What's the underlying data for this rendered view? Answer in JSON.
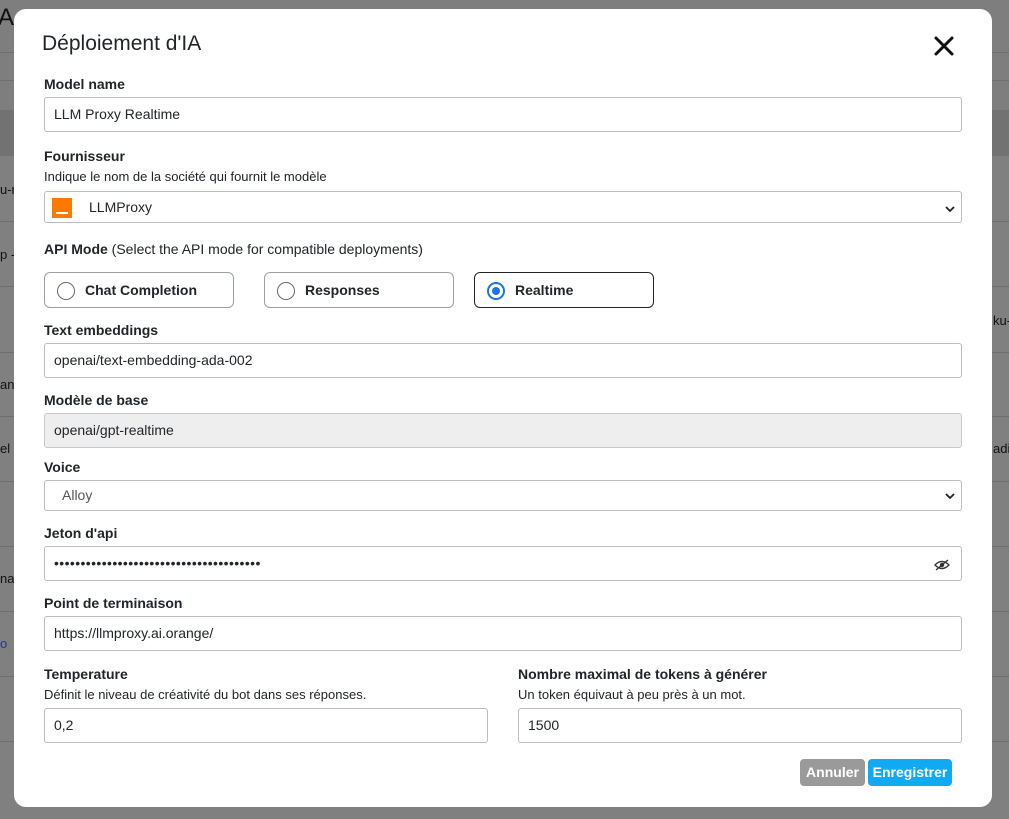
{
  "background": {
    "title": "A",
    "fragments": [
      "u-n",
      "p -",
      "ant",
      "el",
      "na",
      "o",
      "ku-",
      "adi"
    ]
  },
  "modal": {
    "title": "Déploiement d'IA",
    "close_icon": "close-icon"
  },
  "model_name": {
    "label": "Model name",
    "value": "LLM Proxy Realtime"
  },
  "provider": {
    "label": "Fournisseur",
    "hint": "Indique le nom de la société qui fournit le modèle",
    "value": "LLMProxy",
    "logo_color": "#ff7900"
  },
  "api_mode": {
    "label": "API Mode",
    "hint": "(Select the API mode for compatible deployments)",
    "options": [
      {
        "label": "Chat Completion",
        "selected": false
      },
      {
        "label": "Responses",
        "selected": false
      },
      {
        "label": "Realtime",
        "selected": true
      }
    ],
    "accent": "#1a73e8"
  },
  "text_embeddings": {
    "label": "Text embeddings",
    "value": "openai/text-embedding-ada-002"
  },
  "base_model": {
    "label": "Modèle de base",
    "value": "openai/gpt-realtime"
  },
  "voice": {
    "label": "Voice",
    "value": "Alloy"
  },
  "api_token": {
    "label": "Jeton d'api",
    "value": "•••••••••••••••••••••••••••••••••••••••",
    "icon": "eye-slash-icon"
  },
  "endpoint": {
    "label": "Point de terminaison",
    "value": "https://llmproxy.ai.orange/"
  },
  "temperature": {
    "label": "Temperature",
    "hint": "Définit le niveau de créativité du bot dans ses réponses.",
    "value": "0,2"
  },
  "max_tokens": {
    "label": "Nombre maximal de tokens à générer",
    "hint": "Un token équivaut à peu près à un mot.",
    "value": "1500"
  },
  "actions": {
    "cancel_label": "Annuler",
    "save_label": "Enregistrer",
    "cancel_color": "#9a9a9a",
    "save_color": "#11a9f2"
  }
}
